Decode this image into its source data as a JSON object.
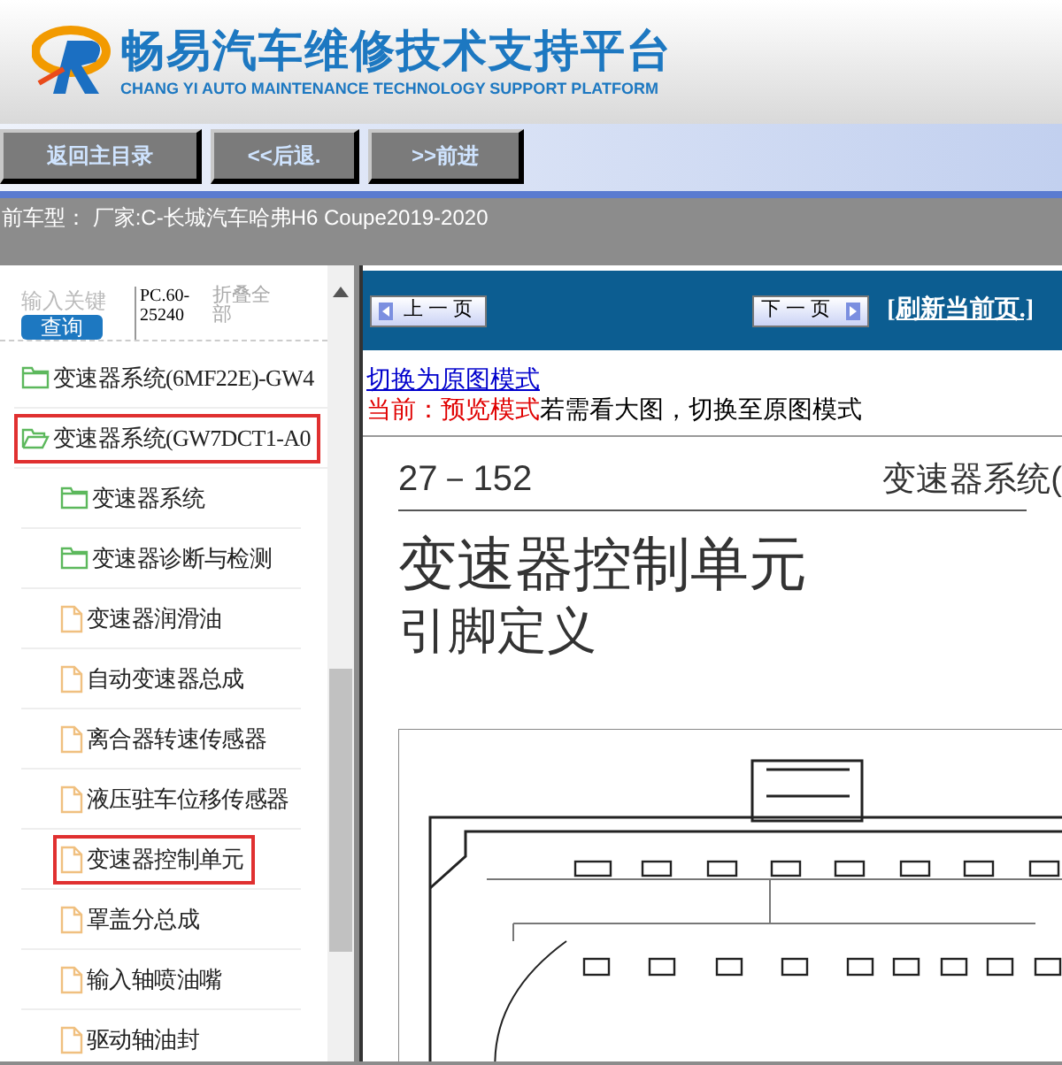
{
  "header": {
    "title": "畅易汽车维修技术支持平台",
    "subtitle": "CHANG YI AUTO MAINTENANCE TECHNOLOGY SUPPORT PLATFORM"
  },
  "nav_buttons": [
    "返回主目录",
    "<<后退.",
    ">>前进"
  ],
  "current_vehicle": "前车型： 厂家:C-长城汽车哈弗H6 Coupe2019-2020",
  "sidebar": {
    "search": {
      "placeholder": "输入关键"
    },
    "search_button": "查询",
    "code": "PC.60-25240",
    "collapse_all": "折叠全部",
    "tree": [
      {
        "kind": "folder",
        "label": "变速器系统(6MF22E)-GW4",
        "expanded": false,
        "selected": false
      },
      {
        "kind": "folder",
        "label": "变速器系统(GW7DCT1-A0",
        "expanded": true,
        "selected": true,
        "children": [
          {
            "kind": "folder",
            "label": "变速器系统",
            "expanded": false,
            "selected": false
          },
          {
            "kind": "folder",
            "label": "变速器诊断与检测",
            "expanded": false,
            "selected": false
          },
          {
            "kind": "file",
            "label": "变速器润滑油",
            "selected": false
          },
          {
            "kind": "file",
            "label": "自动变速器总成",
            "selected": false
          },
          {
            "kind": "file",
            "label": "离合器转速传感器",
            "selected": false
          },
          {
            "kind": "file",
            "label": "液压驻车位移传感器",
            "selected": false
          },
          {
            "kind": "file",
            "label": "变速器控制单元",
            "selected": true
          },
          {
            "kind": "file",
            "label": "罩盖分总成",
            "selected": false
          },
          {
            "kind": "file",
            "label": "输入轴喷油嘴",
            "selected": false
          },
          {
            "kind": "file",
            "label": "驱动轴油封",
            "selected": false
          }
        ]
      }
    ]
  },
  "toolbar": {
    "prev_page": "上一页",
    "next_page": "下一页",
    "refresh": "[刷新当前页.]"
  },
  "mode": {
    "switch_link": "切换为原图模式",
    "current_label": "当前：预览模式",
    "hint": "若需看大图，切换至原图模式"
  },
  "document": {
    "page_number": "27－152",
    "section": "变速器系统(",
    "title": "变速器控制单元",
    "subtitle": "引脚定义"
  }
}
